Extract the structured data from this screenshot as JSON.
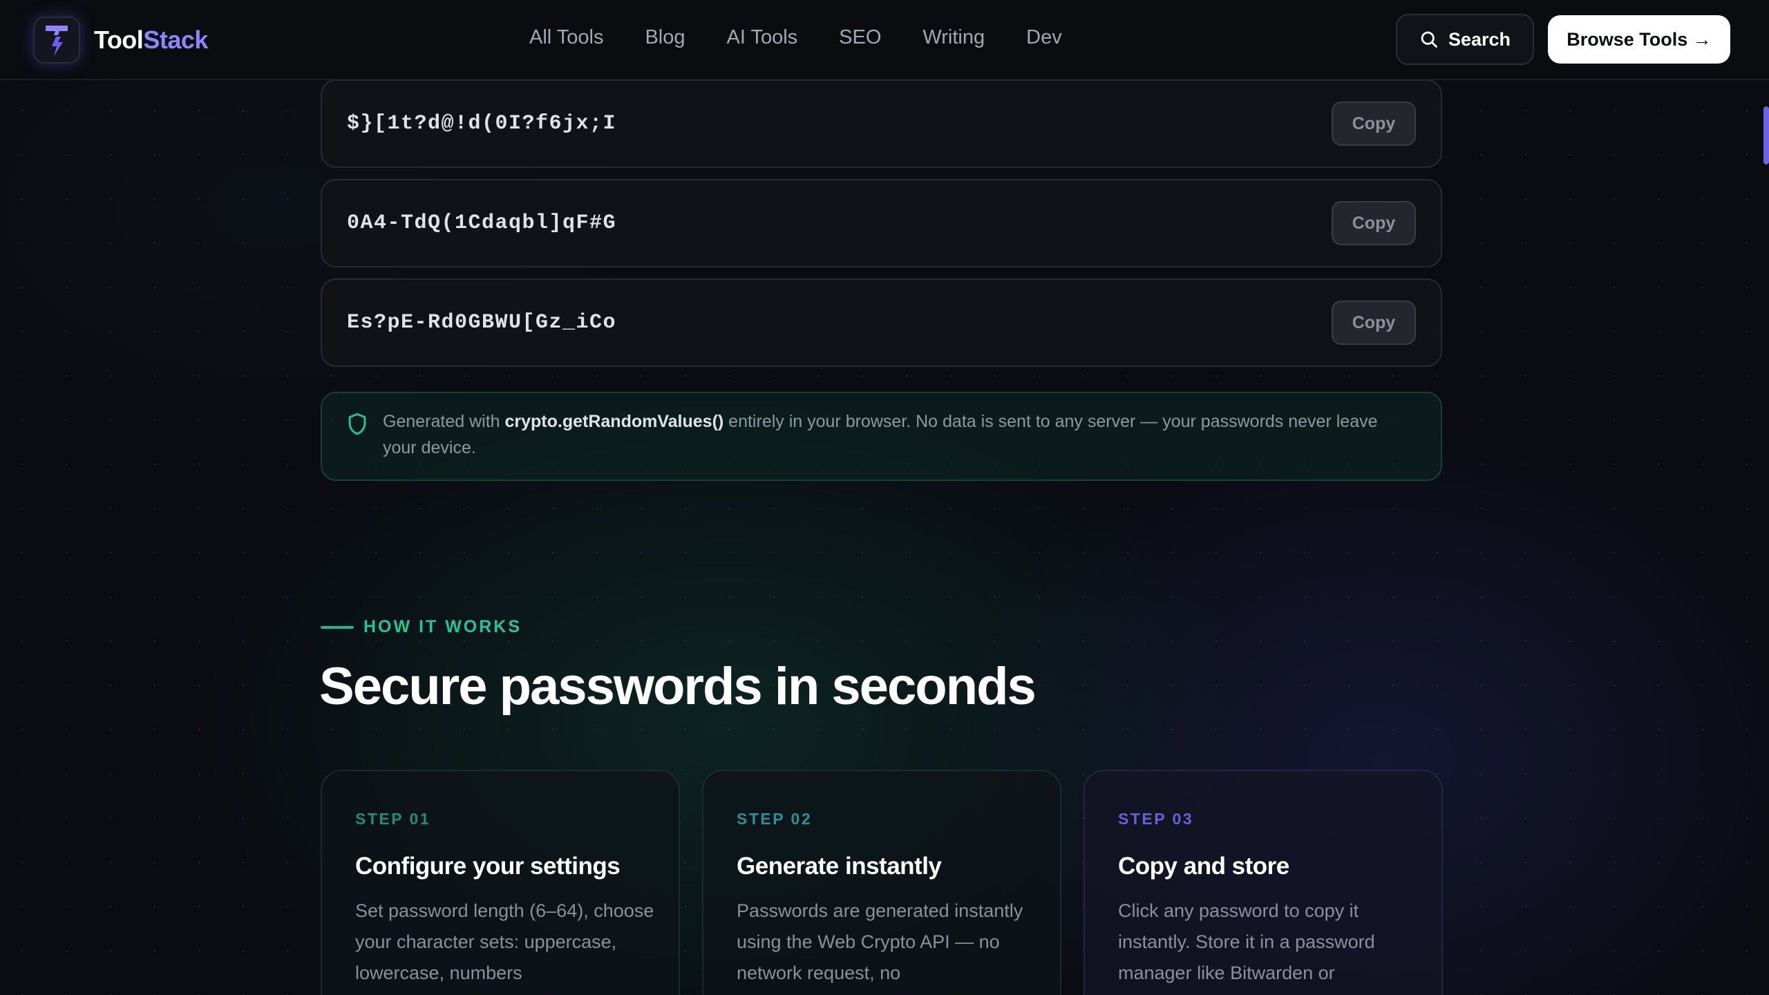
{
  "brand": {
    "name_part1": "Tool",
    "name_part2": "Stack",
    "logo_icon": "lightning-t-icon"
  },
  "nav": {
    "items": [
      {
        "label": "All Tools"
      },
      {
        "label": "Blog"
      },
      {
        "label": "AI Tools"
      },
      {
        "label": "SEO"
      },
      {
        "label": "Writing"
      },
      {
        "label": "Dev"
      }
    ]
  },
  "header": {
    "search_label": "Search",
    "browse_label": "Browse Tools →"
  },
  "passwords": {
    "copy_label": "Copy",
    "items": [
      {
        "value": "$}[1t?d@!d(0I?f6jx;I"
      },
      {
        "value": "0A4-TdQ(1Cdaqbl]qF#G"
      },
      {
        "value": "Es?pE-Rd0GBWU[Gz_iCo"
      }
    ]
  },
  "notice": {
    "prefix": "Generated with ",
    "api": "crypto.getRandomValues()",
    "suffix": " entirely in your browser. No data is sent to any server — your passwords never leave your device."
  },
  "section": {
    "eyebrow": "HOW IT WORKS",
    "title": "Secure passwords in seconds",
    "steps": [
      {
        "step": "STEP 01",
        "title": "Configure your settings",
        "desc": "Set password length (6–64), choose your character sets: uppercase, lowercase, numbers",
        "color": "#1f8f6d"
      },
      {
        "step": "STEP 02",
        "title": "Generate instantly",
        "desc": "Passwords are generated instantly using the Web Crypto API — no network request, no",
        "color": "#2b8f9a"
      },
      {
        "step": "STEP 03",
        "title": "Copy and store",
        "desc": "Click any password to copy it instantly. Store it in a password manager like Bitwarden or",
        "color": "#6b5fd6"
      }
    ]
  },
  "colors": {
    "accent_green": "#27c494",
    "accent_purple": "#8f86ff",
    "background": "#0a0c12"
  }
}
